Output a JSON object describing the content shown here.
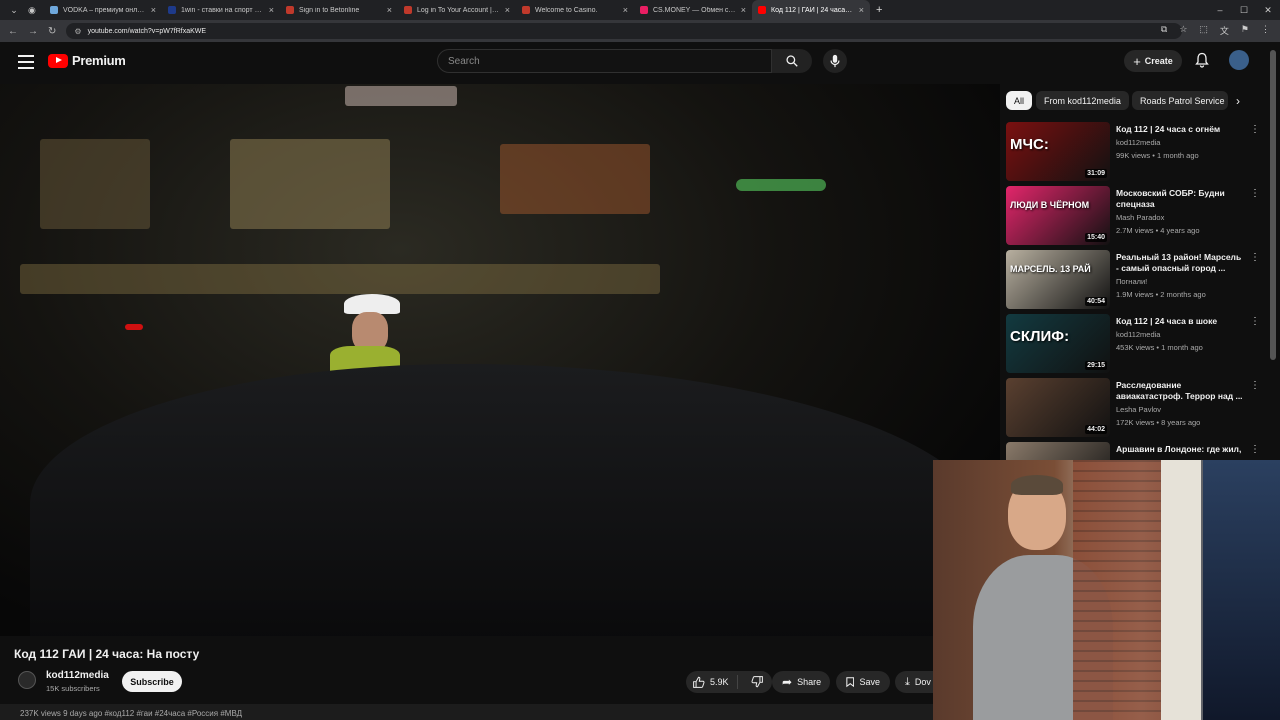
{
  "browser": {
    "tabs": [
      {
        "title": "VODKA – премиум онлайн-ка",
        "color": "#6fa8dc"
      },
      {
        "title": "1win - ставки на спорт - 5764",
        "color": "#1e3a8a"
      },
      {
        "title": "Sign in to Betonline",
        "color": "#c0392b"
      },
      {
        "title": "Log in To Your Account | BetOr",
        "color": "#c0392b"
      },
      {
        "title": "Welcome to Casino.",
        "color": "#c0392b"
      },
      {
        "title": "CS.MONEY — Обмен скинов С",
        "color": "#e91e63"
      },
      {
        "title": "Код 112 | ГАИ | 24 часа: На",
        "color": "#ff0000"
      }
    ],
    "url": "youtube.com/watch?v=pW7fRfxaKWE"
  },
  "header": {
    "logo_text": "Premium",
    "search_placeholder": "Search",
    "create_label": "Create"
  },
  "video": {
    "title": "Код 112 ГАИ | 24 часа: На посту",
    "channel": "kod112media",
    "subscribers": "15K subscribers",
    "subscribe_label": "Subscribe",
    "likes": "5.9K",
    "share_label": "Share",
    "save_label": "Save",
    "download_label": "Dov",
    "meta_partial": "237K views  9 days ago  #код112 #гаи #24часа #Россия #МВД"
  },
  "chips": [
    "All",
    "From kod112media",
    "Roads Patrol Service"
  ],
  "recommendations": [
    {
      "title": "Код 112 | 24 часа с огнём",
      "channel": "kod112media",
      "meta": "99K views • 1 month ago",
      "duration": "31:09",
      "thumb_color": "#7a1010",
      "thumb_text": "МЧС:"
    },
    {
      "title": "Московский СОБР: Будни спецназа",
      "channel": "Mash Paradox",
      "meta": "2.7M views • 4 years ago",
      "duration": "15:40",
      "thumb_color": "#e3266b",
      "thumb_text": "ЛЮДИ В ЧЁРНОМ"
    },
    {
      "title": "Реальный 13 район! Марсель - самый опасный город ...",
      "channel": "Погнали!",
      "meta": "1.9M views • 2 months ago",
      "duration": "40:54",
      "thumb_color": "#b8b0a0",
      "thumb_text": "МАРСЕЛЬ. 13 РАЙ"
    },
    {
      "title": "Код 112 | 24 часа в шоке",
      "channel": "kod112media",
      "meta": "453K views • 1 month ago",
      "duration": "29:15",
      "thumb_color": "#123a40",
      "thumb_text": "СКЛИФ:"
    },
    {
      "title": "Расследование авиакатастроф. Террор над ...",
      "channel": "Lesha Pavlov",
      "meta": "172K views • 8 years ago",
      "duration": "44:02",
      "thumb_color": "#5a4030",
      "thumb_text": ""
    },
    {
      "title": "Аршавин в Лондоне: где жил,",
      "channel": "",
      "meta": "",
      "duration": "",
      "thumb_color": "#8a7a6a",
      "thumb_text": ""
    }
  ]
}
